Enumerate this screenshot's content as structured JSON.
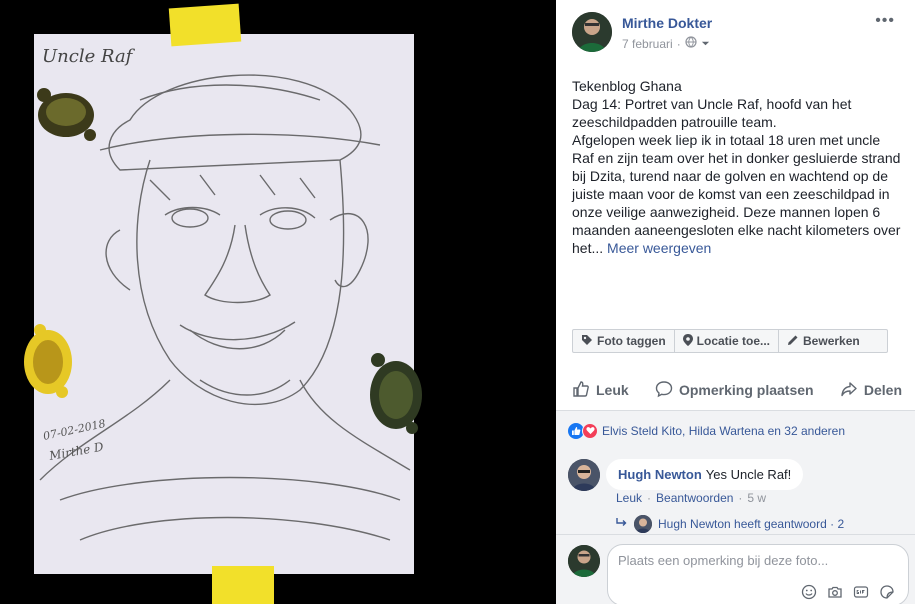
{
  "photo": {
    "sketch_caption": "Uncle Raf",
    "sketch_date": "07-02-2018",
    "sketch_signature": "Mirthe D"
  },
  "post": {
    "author": "Mirthe Dokter",
    "date": "7 februari",
    "text_lines": [
      "Tekenblog Ghana",
      "Dag 14: Portret van Uncle Raf, hoofd van het zeeschildpadden patrouille team.",
      "Afgelopen week liep ik in totaal 18 uren met uncle Raf en zijn team over het in donker gesluierde strand bij Dzita, turend naar de golven en wachtend op de juiste maan voor de komst van een zeeschildpad in onze veilige aanwezigheid. Deze mannen lopen 6 maanden aaneengesloten elke nacht kilometers over het..."
    ],
    "more_label": "Meer weergeven"
  },
  "tag_bar": {
    "tag_photo": "Foto taggen",
    "location": "Locatie toe...",
    "edit": "Bewerken"
  },
  "actions": {
    "like": "Leuk",
    "comment": "Opmerking plaatsen",
    "share": "Delen"
  },
  "reactions": {
    "summary": "Elvis Steld Kito, Hilda Wartena en 32 anderen"
  },
  "comment": {
    "author": "Hugh Newton",
    "text": "Yes Uncle Raf!",
    "like": "Leuk",
    "reply": "Beantwoorden",
    "time": "5 w",
    "reply_summary": "Hugh Newton heeft geantwoord · 2"
  },
  "compose": {
    "placeholder": "Plaats een opmerking bij deze foto..."
  },
  "colors": {
    "link": "#385898",
    "like_blue": "#1877f2",
    "love_red": "#f33e58",
    "tape_yellow": "#f2e02a"
  }
}
